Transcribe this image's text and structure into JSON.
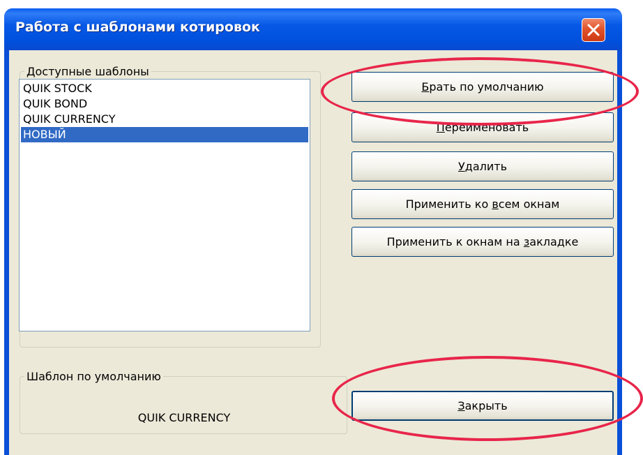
{
  "window": {
    "title": "Работа с шаблонами котировок",
    "close_icon": "close-icon"
  },
  "available_templates": {
    "legend": "Доступные шаблоны",
    "items": [
      {
        "label": "QUIK STOCK",
        "selected": false
      },
      {
        "label": "QUIK BOND",
        "selected": false
      },
      {
        "label": "QUIK CURRENCY",
        "selected": false
      },
      {
        "label": "НОВЫЙ",
        "selected": true
      }
    ]
  },
  "buttons": {
    "default": {
      "pre": "",
      "key": "Б",
      "post": "рать по умолчанию"
    },
    "rename": {
      "pre": "",
      "key": "П",
      "post": "ереименовать"
    },
    "delete": {
      "pre": "",
      "key": "У",
      "post": "далить"
    },
    "apply_all": {
      "pre": "Применить ко ",
      "key": "в",
      "post": "сем окнам"
    },
    "apply_tab": {
      "pre": "Применить к окнам на ",
      "key": "з",
      "post": "акладке"
    },
    "close": {
      "pre": "",
      "key": "З",
      "post": "акрыть"
    }
  },
  "default_template": {
    "legend": "Шаблон по умолчанию",
    "value": "QUIK CURRENCY"
  },
  "colors": {
    "titlebar": "#0058e6",
    "selection": "#316ac5",
    "dialog_bg": "#ece9d8",
    "annotation": "#e8254a"
  }
}
